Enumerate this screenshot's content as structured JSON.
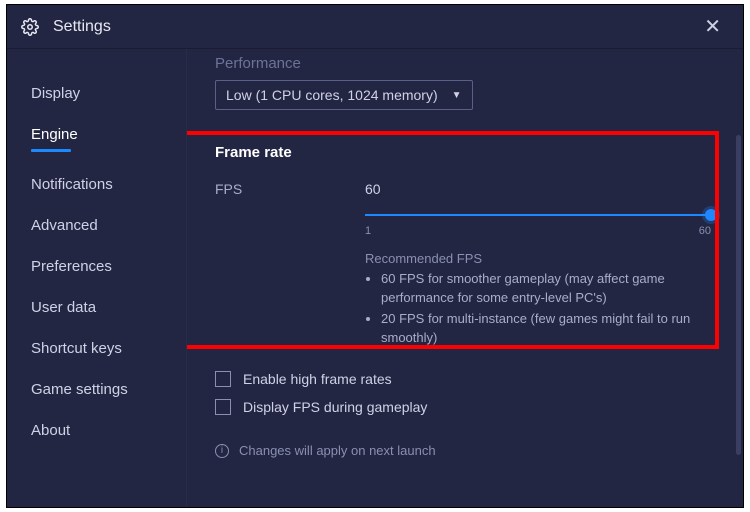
{
  "title": "Settings",
  "sidebar": {
    "items": [
      {
        "label": "Display"
      },
      {
        "label": "Engine"
      },
      {
        "label": "Notifications"
      },
      {
        "label": "Advanced"
      },
      {
        "label": "Preferences"
      },
      {
        "label": "User data"
      },
      {
        "label": "Shortcut keys"
      },
      {
        "label": "Game settings"
      },
      {
        "label": "About"
      }
    ],
    "active_index": 1
  },
  "content": {
    "performance_label": "Performance",
    "performance_value": "Low (1 CPU cores, 1024 memory)",
    "frame_rate": {
      "section_title": "Frame rate",
      "fps_label": "FPS",
      "fps_value": "60",
      "slider_min": "1",
      "slider_max": "60",
      "recommended_title": "Recommended FPS",
      "recommended_items": [
        "60 FPS for smoother gameplay (may affect game performance for some entry-level PC's)",
        "20 FPS for multi-instance (few games might fail to run smoothly)"
      ]
    },
    "checkboxes": {
      "high_frame_rates": "Enable high frame rates",
      "display_fps": "Display FPS during gameplay"
    },
    "notice": "Changes will apply on next launch"
  }
}
